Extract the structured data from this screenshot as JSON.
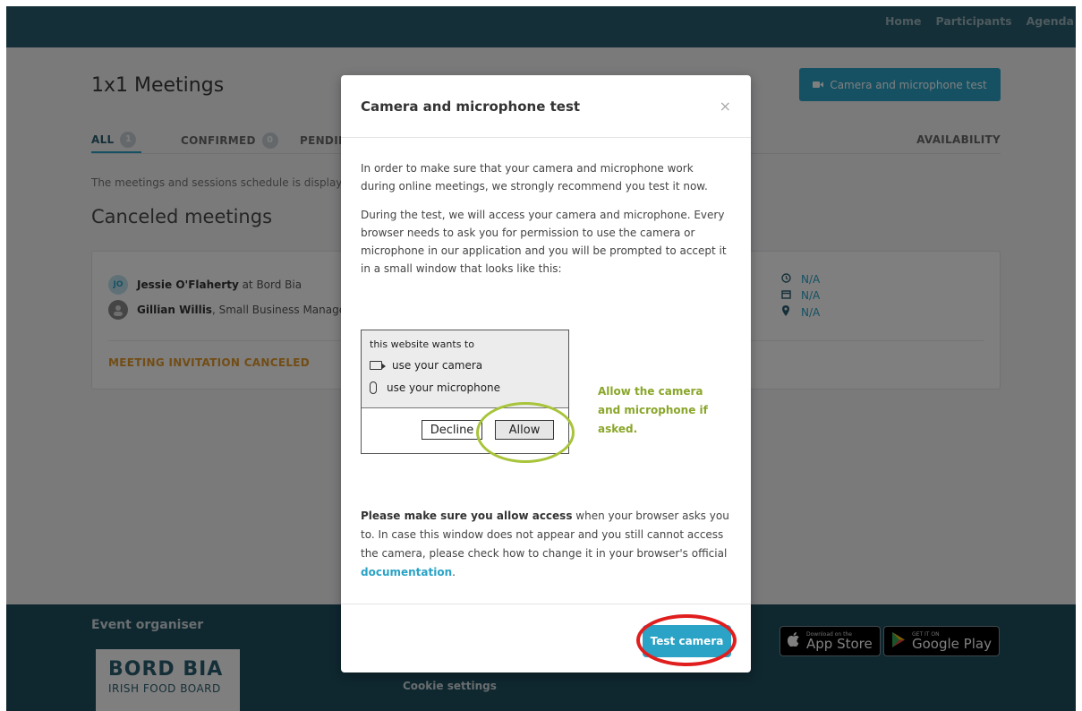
{
  "nav": {
    "links": [
      "Home",
      "Participants",
      "Agenda"
    ]
  },
  "page": {
    "title": "1x1 Meetings",
    "cam_button": "Camera and microphone test",
    "tabs": [
      {
        "label": "ALL",
        "count": "1"
      },
      {
        "label": "CONFIRMED",
        "count": "0"
      },
      {
        "label": "PENDING",
        "count": ""
      }
    ],
    "availability_tab": "AVAILABILITY",
    "info_text": "The meetings and sessions schedule is displaye",
    "section_title": "Canceled meetings"
  },
  "meeting": {
    "person1": {
      "initials": "JO",
      "name": "Jessie O'Flaherty",
      "rest": " at Bord Bia"
    },
    "person2": {
      "name": "Gillian Willis",
      "rest": ", Small Business Manage"
    },
    "time": "N/A",
    "date": "N/A",
    "location": "N/A",
    "status": "MEETING INVITATION CANCELED"
  },
  "footer": {
    "organiser": "Event organiser",
    "logo_line1": "BORD BIA",
    "logo_line2": "IRISH FOOD BOARD",
    "cookie": "Cookie settings",
    "appstore_small": "Download on the",
    "appstore_large": "App Store",
    "googleplay_small": "GET IT ON",
    "googleplay_large": "Google Play"
  },
  "modal": {
    "title": "Camera and microphone test",
    "close": "×",
    "para1": "In order to make sure that your camera and microphone work during online meetings, we strongly recommend you test it now.",
    "para2": "During the test, we will access your camera and microphone. Every browser needs to ask you for permission to use the camera or microphone in our application and you will be prompted to accept it in a small window that looks like this:",
    "demo": {
      "wants": "this website wants to",
      "camera": "use your camera",
      "microphone": "use your microphone",
      "decline": "Decline",
      "allow": "Allow"
    },
    "allow_hint": "Allow the camera and microphone if asked.",
    "bottom_bold": "Please make sure you allow access",
    "bottom_text": " when your browser asks you to. In case this window does not appear and you still cannot access the camera, please check how to change it in your browser's official ",
    "doc_link": "documentation",
    "bottom_end": ".",
    "test_button": "Test camera"
  },
  "colors": {
    "nav_bg": "#2a5f70",
    "accent": "#2aa3c6",
    "warning": "#e59a2c",
    "hint_green": "#8aa62a",
    "highlight_red": "#e01e1e"
  }
}
